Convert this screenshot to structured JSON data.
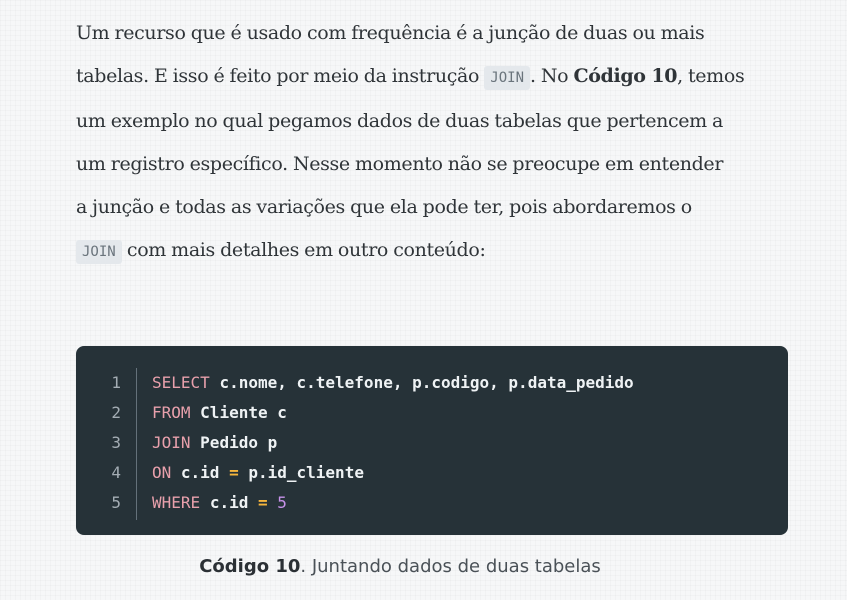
{
  "paragraph": {
    "line1": "Um recurso que é usado com frequência é a junção de duas ou mais",
    "line2_a": "tabelas. E isso é feito por meio da instrução",
    "line2_code": "JOIN",
    "line2_b": ". No",
    "line2_bold": "Código 10",
    "line2_c": ", temos",
    "line3": "um exemplo no qual pegamos dados de duas tabelas que pertencem a",
    "line4": "um registro específico. Nesse momento não se preocupe em entender",
    "line5": "a junção e todas as variações que ela pode ter, pois abordaremos o",
    "line6_code": "JOIN",
    "line6_b": "com mais detalhes em outro conteúdo:"
  },
  "code": {
    "line_numbers": [
      "1",
      "2",
      "3",
      "4",
      "5"
    ],
    "lines": [
      {
        "kw": "SELECT",
        "text": "c.nome, c.telefone, p.codigo, p.data_pedido"
      },
      {
        "kw": "FROM",
        "text": "Cliente c"
      },
      {
        "kw": "JOIN",
        "text": "Pedido p"
      },
      {
        "kw": "ON",
        "text": "c.id",
        "op": "=",
        "text2": "p.id_cliente"
      },
      {
        "kw": "WHERE",
        "text": "c.id",
        "op": "=",
        "num": "5"
      }
    ]
  },
  "caption": {
    "label": "Código 10",
    "text": ". Juntando dados de duas tabelas"
  }
}
